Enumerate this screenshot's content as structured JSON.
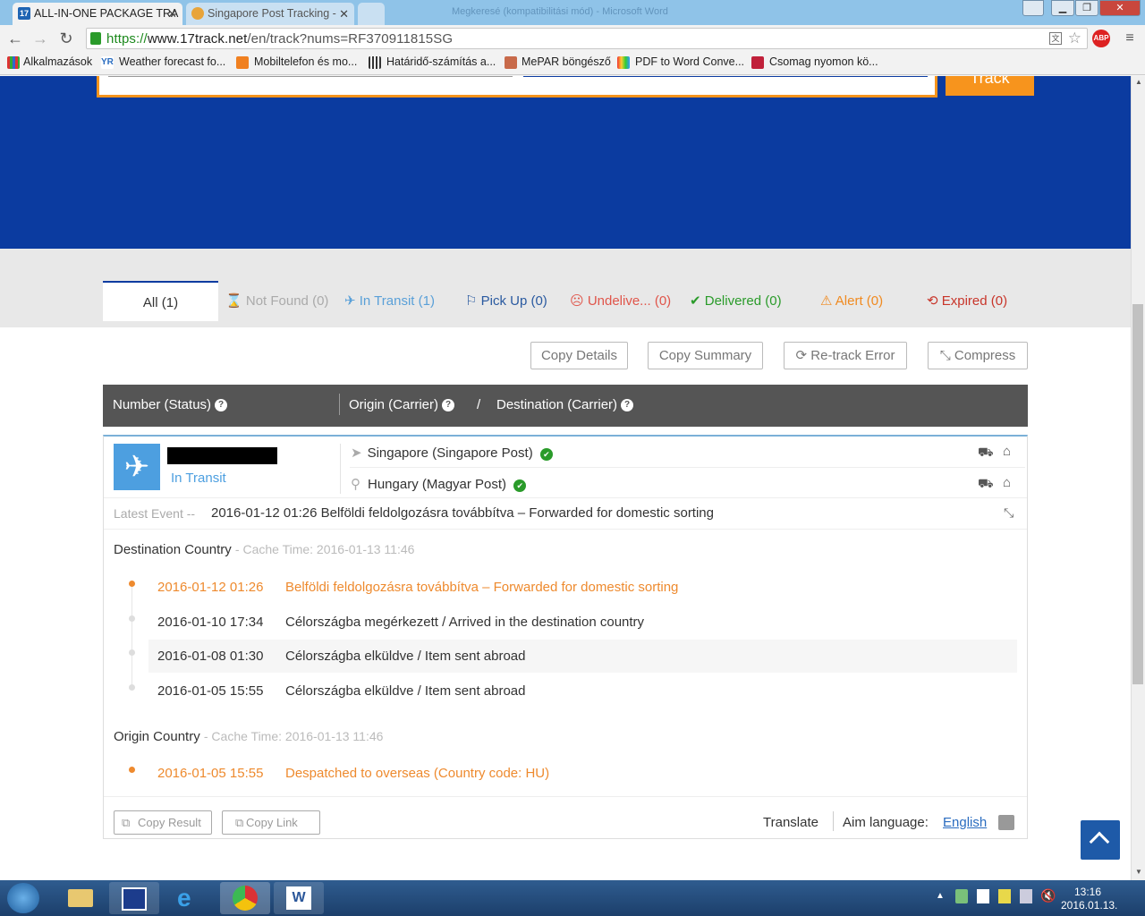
{
  "browser": {
    "tabs": [
      {
        "favicon": "17",
        "title": "ALL-IN-ONE PACKAGE TRA"
      },
      {
        "title": "Singapore Post Tracking -"
      }
    ],
    "bg_window_title": "Megkeresé (kompatibilitási mód) - Microsoft Word",
    "url_scheme": "https://",
    "url_host": "www.17track.net",
    "url_path": "/en/track?nums=RF370911815SG",
    "abp_label": "ABP",
    "bookmarks": [
      "Alkalmazások",
      "Weather forecast fo...",
      "Mobiltelefon és mo...",
      "Határidő-számítás a...",
      "MePAR böngésző",
      "PDF to Word Conve...",
      "Csomag nyomon kö..."
    ]
  },
  "hero": {
    "track_label": "Track",
    "accent": "#f7941d",
    "brand": "#0b3ba0"
  },
  "filters": {
    "all": "All (1)",
    "not_found": "Not Found (0)",
    "in_transit": "In Transit (1)",
    "pick_up": "Pick Up (0)",
    "undelivered": "Undelive... (0)",
    "delivered": "Delivered (0)",
    "alert": "Alert (0)",
    "expired": "Expired (0)"
  },
  "actions": {
    "copy_details": "Copy Details",
    "copy_summary": "Copy Summary",
    "retrack": "Re-track Error",
    "compress": "Compress"
  },
  "table_header": {
    "number": "Number (Status)",
    "origin": "Origin (Carrier)",
    "slash": "/",
    "destination": "Destination (Carrier)"
  },
  "shipment": {
    "status": "In Transit",
    "origin": "Singapore (Singapore Post)",
    "destination": "Hungary (Magyar Post)",
    "latest_label": "Latest Event --",
    "latest_event": "2016-01-12 01:26 Belföldi feldolgozásra továbbítva – Forwarded for domestic sorting",
    "dest_section": "Destination Country",
    "dest_cache": "- Cache Time: 2016-01-13 11:46",
    "dest_events": [
      {
        "time": "2016-01-12 01:26",
        "text": "Belföldi feldolgozásra továbbítva – Forwarded for domestic sorting"
      },
      {
        "time": "2016-01-10 17:34",
        "text": "Célországba megérkezett / Arrived in the destination country"
      },
      {
        "time": "2016-01-08 01:30",
        "text": "Célországba elküldve / Item sent abroad"
      },
      {
        "time": "2016-01-05 15:55",
        "text": "Célországba elküldve / Item sent abroad"
      }
    ],
    "origin_section": "Origin Country",
    "origin_cache": "- Cache Time: 2016-01-13 11:46",
    "origin_events": [
      {
        "time": "2016-01-05 15:55",
        "text": "Despatched to overseas (Country code: HU)"
      }
    ]
  },
  "footer_actions": {
    "copy_result": "Copy Result",
    "copy_link": "Copy Link",
    "translate": "Translate",
    "aim_language": "Aim language:",
    "language": "English"
  },
  "taskbar": {
    "time": "13:16",
    "date": "2016.01.13."
  }
}
